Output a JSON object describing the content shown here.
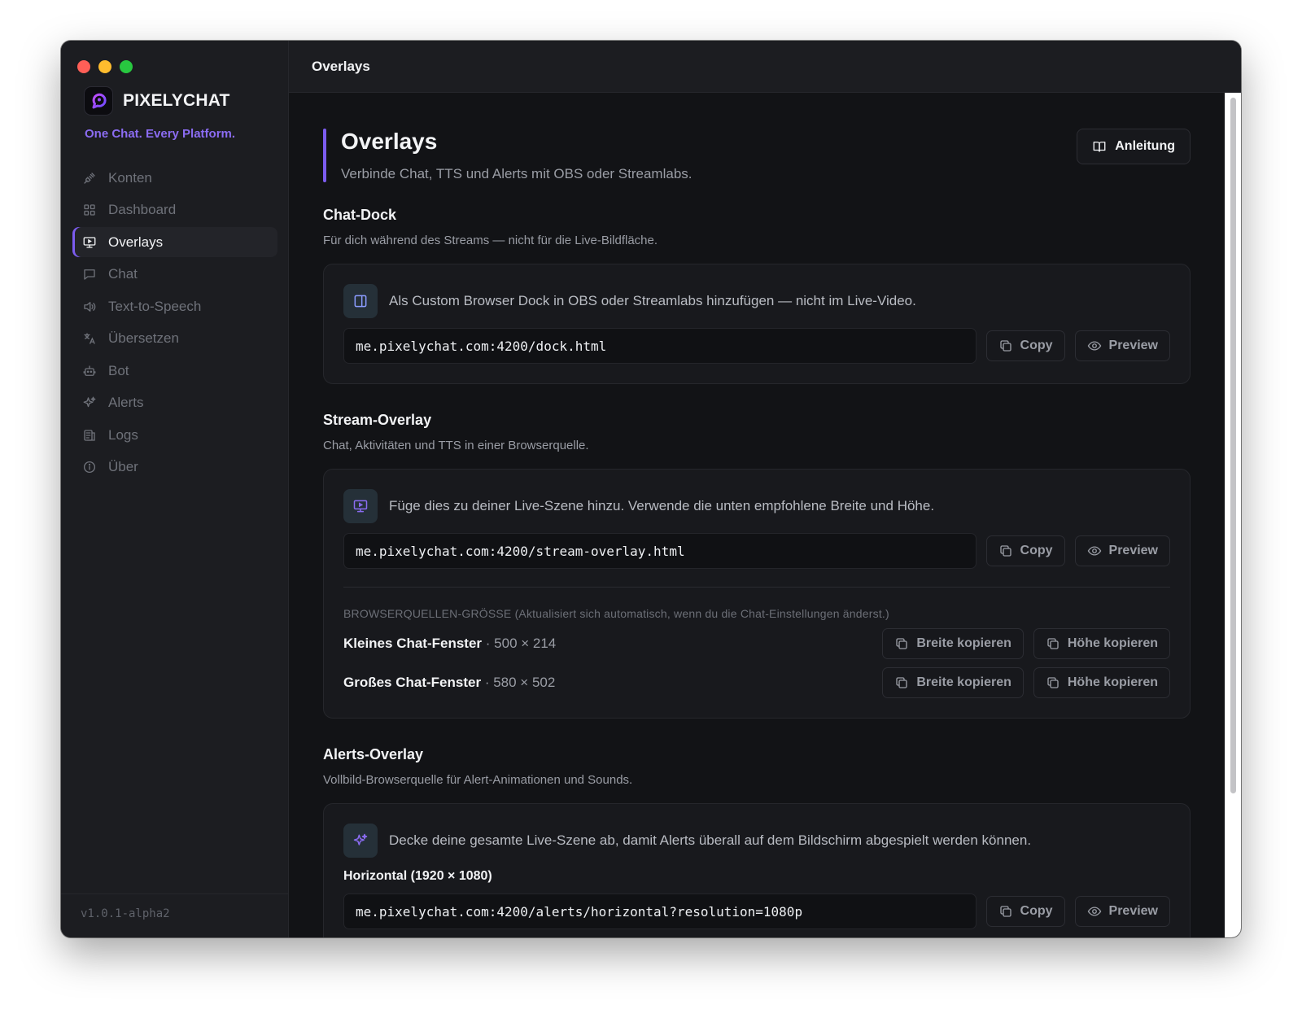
{
  "app": {
    "brand_name": "PIXELYCHAT",
    "tagline": "One Chat. Every Platform.",
    "version": "v1.0.1-alpha2",
    "window_title": "Overlays",
    "accent_color": "#7c5cf0"
  },
  "sidebar": {
    "items": [
      {
        "label": "Konten",
        "icon": "plug-icon"
      },
      {
        "label": "Dashboard",
        "icon": "grid-icon"
      },
      {
        "label": "Overlays",
        "icon": "monitor-play-icon",
        "active": true
      },
      {
        "label": "Chat",
        "icon": "chat-bubble-icon"
      },
      {
        "label": "Text-to-Speech",
        "icon": "speaker-icon"
      },
      {
        "label": "Übersetzen",
        "icon": "translate-icon"
      },
      {
        "label": "Bot",
        "icon": "bot-icon"
      },
      {
        "label": "Alerts",
        "icon": "sparkles-icon"
      },
      {
        "label": "Logs",
        "icon": "logs-icon"
      },
      {
        "label": "Über",
        "icon": "info-icon"
      }
    ]
  },
  "page": {
    "title": "Overlays",
    "subtitle": "Verbinde Chat, TTS und Alerts mit OBS oder Streamlabs.",
    "guide_button": "Anleitung"
  },
  "buttons": {
    "copy": "Copy",
    "preview": "Preview",
    "copy_width": "Breite kopieren",
    "copy_height": "Höhe kopieren"
  },
  "chat_dock": {
    "title": "Chat-Dock",
    "subtitle": "Für dich während des Streams — nicht für die Live-Bildfläche.",
    "info": "Als Custom Browser Dock in OBS oder Streamlabs hinzufügen — nicht im Live-Video.",
    "url": "me.pixelychat.com:4200/dock.html"
  },
  "stream_overlay": {
    "title": "Stream-Overlay",
    "subtitle": "Chat, Aktivitäten und TTS in einer Browserquelle.",
    "info": "Füge dies zu deiner Live-Szene hinzu. Verwende die unten empfohlene Breite und Höhe.",
    "url": "me.pixelychat.com:4200/stream-overlay.html",
    "size_caption": "BROWSERQUELLEN-GRÖSSE",
    "size_note": "(Aktualisiert sich automatisch, wenn du die Chat-Einstellungen änderst.)",
    "sizes": [
      {
        "label": "Kleines Chat-Fenster",
        "dims": "500 × 214"
      },
      {
        "label": "Großes Chat-Fenster",
        "dims": "580 × 502"
      }
    ]
  },
  "alerts_overlay": {
    "title": "Alerts-Overlay",
    "subtitle": "Vollbild-Browserquelle für Alert-Animationen und Sounds.",
    "info": "Decke deine gesamte Live-Szene ab, damit Alerts überall auf dem Bildschirm abgespielt werden können.",
    "resolution_label": "Horizontal (1920 × 1080)",
    "url": "me.pixelychat.com:4200/alerts/horizontal?resolution=1080p"
  }
}
